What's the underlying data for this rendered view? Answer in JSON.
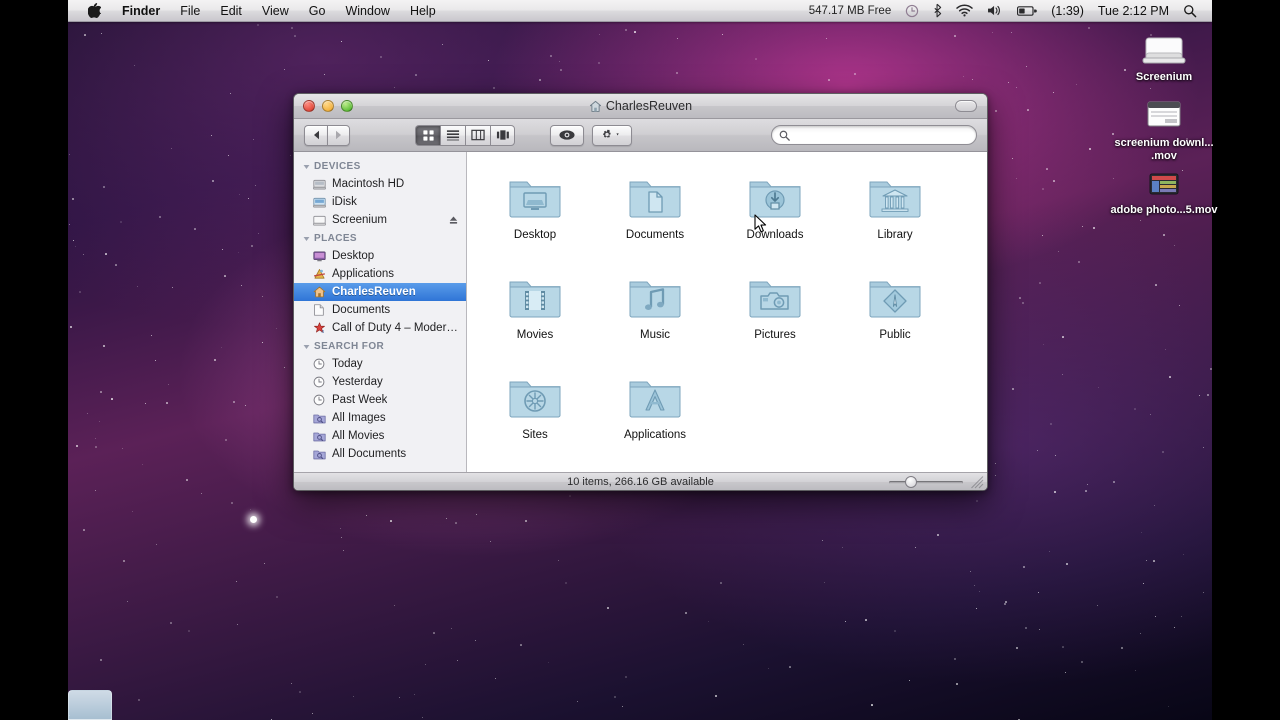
{
  "menubar": {
    "apple_icon": "apple-logo-icon",
    "items": [
      {
        "label": "Finder",
        "bold": true
      },
      {
        "label": "File",
        "bold": false
      },
      {
        "label": "Edit",
        "bold": false
      },
      {
        "label": "View",
        "bold": false
      },
      {
        "label": "Go",
        "bold": false
      },
      {
        "label": "Window",
        "bold": false
      },
      {
        "label": "Help",
        "bold": false
      }
    ],
    "status": {
      "free_space": "547.17 MB Free",
      "time_machine_icon": "clock-icon",
      "bluetooth_icon": "bluetooth-icon",
      "wifi_icon": "wifi-icon",
      "volume_icon": "speaker-icon",
      "battery_icon": "battery-icon",
      "battery_time": "(1:39)",
      "clock": "Tue 2:12 PM",
      "spotlight_icon": "search-icon"
    }
  },
  "desktop": {
    "icons": [
      {
        "label": "Screenium",
        "kind": "disk-icon"
      },
      {
        "label": "screenium downl... .mov",
        "kind": "quicktime-movie-icon"
      },
      {
        "label": "adobe photo...5.mov",
        "kind": "quicktime-movie-icon"
      }
    ]
  },
  "finder": {
    "title": "CharlesReuven",
    "title_icon": "home-icon",
    "traffic_lights": {
      "close": "close-button",
      "minimize": "minimize-button",
      "zoom": "zoom-button"
    },
    "toolbar": {
      "back_label": "Back",
      "forward_label": "Forward",
      "views": [
        {
          "name": "icon-view",
          "active": true
        },
        {
          "name": "list-view",
          "active": false
        },
        {
          "name": "column-view",
          "active": false
        },
        {
          "name": "coverflow-view",
          "active": false
        }
      ],
      "quicklook_label": "Quick Look",
      "action_label": "Action",
      "hide_toolbar_label": "Hide Toolbar"
    },
    "search": {
      "value": "",
      "placeholder": ""
    },
    "sidebar": {
      "sections": [
        {
          "title": "DEVICES",
          "items": [
            {
              "label": "Macintosh HD",
              "icon": "hard-disk-icon",
              "selected": false,
              "eject": false
            },
            {
              "label": "iDisk",
              "icon": "idisk-icon",
              "selected": false,
              "eject": false
            },
            {
              "label": "Screenium",
              "icon": "removable-disk-icon",
              "selected": false,
              "eject": true
            }
          ]
        },
        {
          "title": "PLACES",
          "items": [
            {
              "label": "Desktop",
              "icon": "desktop-icon",
              "selected": false,
              "eject": false
            },
            {
              "label": "Applications",
              "icon": "applications-icon",
              "selected": false,
              "eject": false
            },
            {
              "label": "CharlesReuven",
              "icon": "home-icon",
              "selected": true,
              "eject": false
            },
            {
              "label": "Documents",
              "icon": "documents-icon",
              "selected": false,
              "eject": false
            },
            {
              "label": "Call of Duty 4 – Modern ...",
              "icon": "app-icon",
              "selected": false,
              "eject": false
            }
          ]
        },
        {
          "title": "SEARCH FOR",
          "items": [
            {
              "label": "Today",
              "icon": "clock-icon",
              "selected": false,
              "eject": false
            },
            {
              "label": "Yesterday",
              "icon": "clock-icon",
              "selected": false,
              "eject": false
            },
            {
              "label": "Past Week",
              "icon": "clock-icon",
              "selected": false,
              "eject": false
            },
            {
              "label": "All Images",
              "icon": "smart-folder-icon",
              "selected": false,
              "eject": false
            },
            {
              "label": "All Movies",
              "icon": "smart-folder-icon",
              "selected": false,
              "eject": false
            },
            {
              "label": "All Documents",
              "icon": "smart-folder-icon",
              "selected": false,
              "eject": false
            }
          ]
        }
      ]
    },
    "items": [
      {
        "label": "Desktop",
        "icon": "desktop-folder-icon"
      },
      {
        "label": "Documents",
        "icon": "documents-folder-icon"
      },
      {
        "label": "Downloads",
        "icon": "downloads-folder-icon"
      },
      {
        "label": "Library",
        "icon": "library-folder-icon"
      },
      {
        "label": "Movies",
        "icon": "movies-folder-icon"
      },
      {
        "label": "Music",
        "icon": "music-folder-icon"
      },
      {
        "label": "Pictures",
        "icon": "pictures-folder-icon"
      },
      {
        "label": "Public",
        "icon": "public-folder-icon"
      },
      {
        "label": "Sites",
        "icon": "sites-folder-icon"
      },
      {
        "label": "Applications",
        "icon": "applications-folder-icon"
      }
    ],
    "statusbar": {
      "text": "10 items, 266.16 GB available",
      "zoom_value": "25"
    }
  },
  "colors": {
    "selection_blue": "#2f75d6",
    "folder_blue": "#9dc3d8",
    "sidebar_bg": "#f1f1f4",
    "menubar_text": "#111111"
  }
}
